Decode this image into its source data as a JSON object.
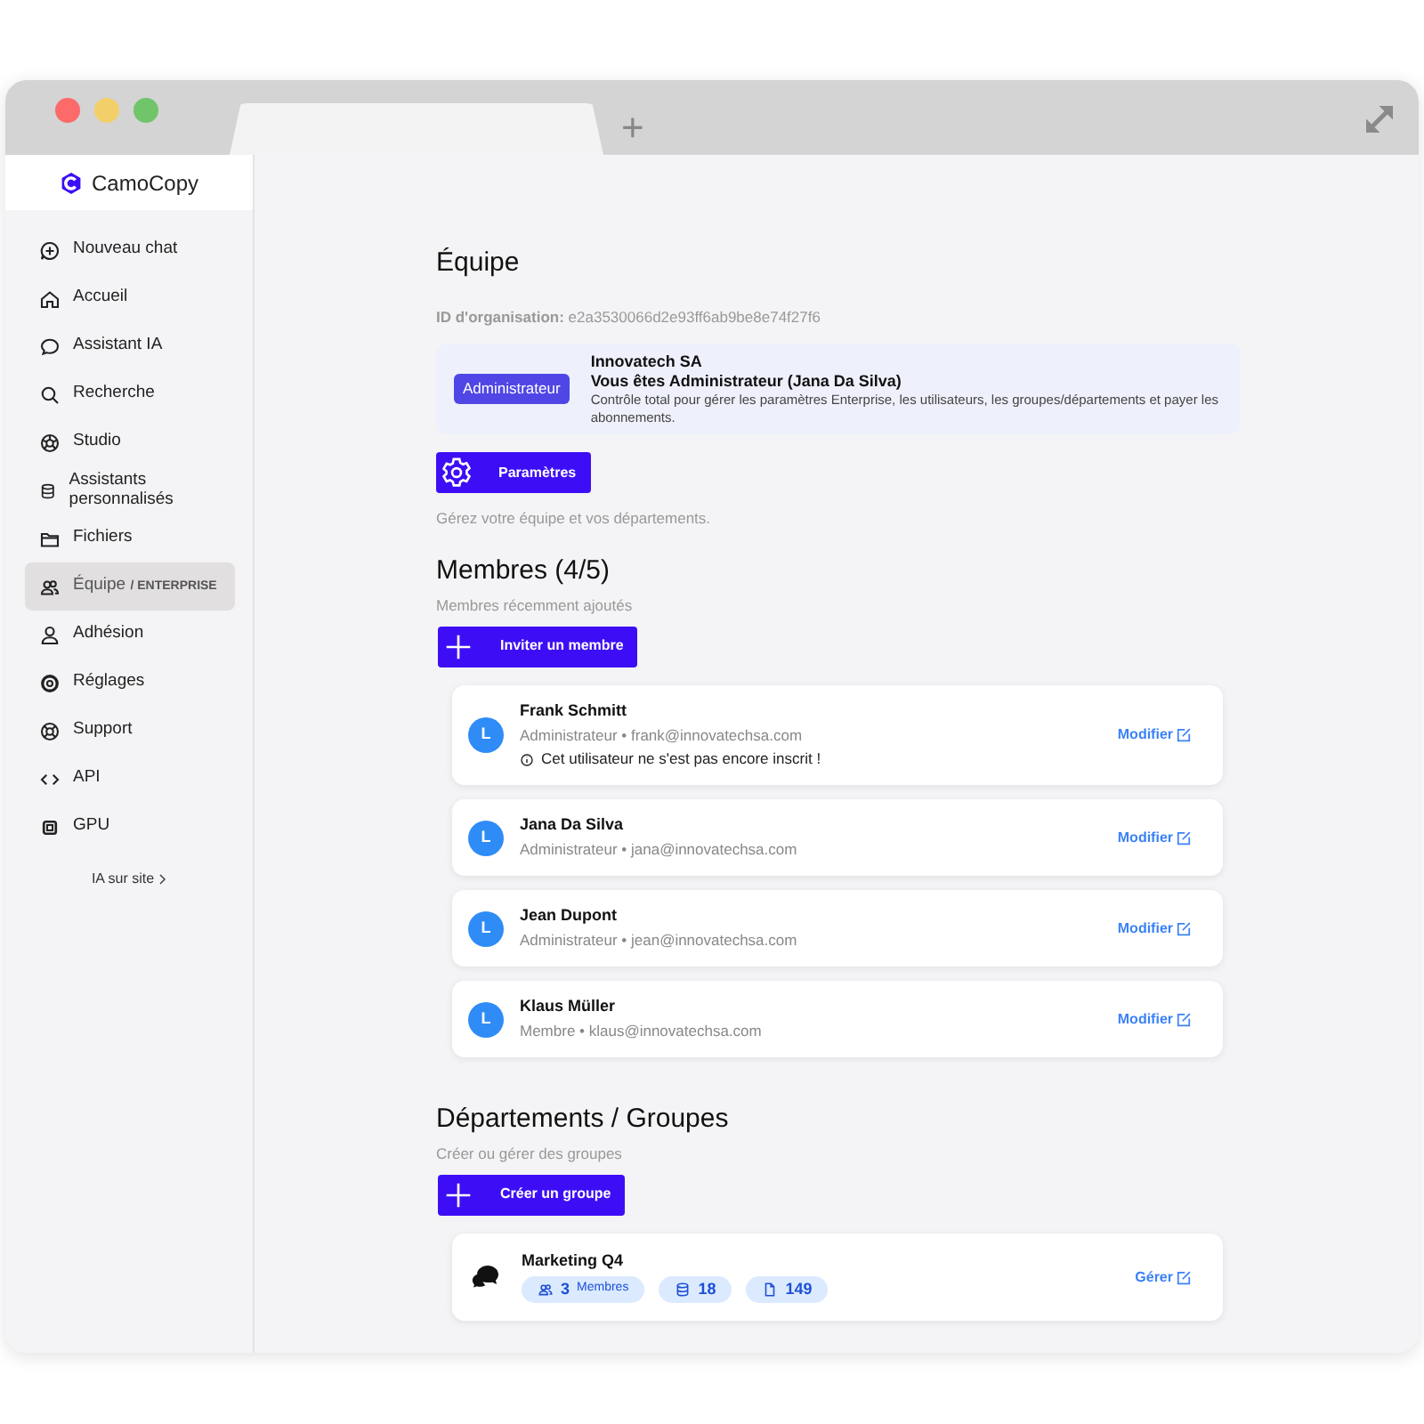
{
  "browser": {
    "new_tab": "+"
  },
  "brand": {
    "name": "CamoCopy"
  },
  "sidebar": {
    "items": [
      {
        "label": "Nouveau chat",
        "selected": false
      },
      {
        "label": "Accueil",
        "selected": false
      },
      {
        "label": "Assistant IA",
        "selected": false
      },
      {
        "label": "Recherche",
        "selected": false
      },
      {
        "label": "Studio",
        "selected": false
      },
      {
        "label": "Assistants personnalisés",
        "selected": false
      },
      {
        "label": "Fichiers",
        "selected": false
      },
      {
        "label": "Équipe",
        "tag": "/ ENTERPRISE",
        "selected": true
      },
      {
        "label": "Adhésion",
        "selected": false
      },
      {
        "label": "Réglages",
        "selected": false
      },
      {
        "label": "Support",
        "selected": false
      },
      {
        "label": "API",
        "selected": false
      },
      {
        "label": "GPU",
        "selected": false
      }
    ],
    "footer_link": "IA sur site"
  },
  "team": {
    "title": "Équipe",
    "org_id_label": "ID d'organisation:",
    "org_id": "e2a3530066d2e93ff6ab9be8e74f27f6",
    "role_badge": "Administrateur",
    "org_name": "Innovatech SA",
    "role_line": "Vous êtes Administrateur (Jana Da Silva)",
    "role_description": "Contrôle total pour gérer les paramètres Enterprise, les utilisateurs, les groupes/départements et payer les abonnements.",
    "settings_button": "Paramètres",
    "hint": "Gérez votre équipe et vos départements."
  },
  "members": {
    "title": "Membres (4/5)",
    "separator": "•",
    "subtitle": "Membres récemment ajoutés",
    "invite_button": "Inviter un membre",
    "items": [
      {
        "avatar": "L",
        "name": "Frank Schmitt",
        "role": "Administrateur",
        "email": "frank@innovatechsa.com",
        "warning": "Cet utilisateur ne s'est pas encore inscrit !",
        "action": "Modifier"
      },
      {
        "avatar": "L",
        "name": "Jana Da Silva",
        "role": "Administrateur",
        "email": "jana@innovatechsa.com",
        "action": "Modifier"
      },
      {
        "avatar": "L",
        "name": "Jean Dupont",
        "role": "Administrateur",
        "email": "jean@innovatechsa.com",
        "action": "Modifier"
      },
      {
        "avatar": "L",
        "name": "Klaus Müller",
        "role": "Membre",
        "email": "klaus@innovatechsa.com",
        "action": "Modifier"
      }
    ]
  },
  "groups": {
    "title": "Départements / Groupes",
    "subtitle": "Créer ou gérer des groupes",
    "create_button": "Créer un groupe",
    "items": [
      {
        "name": "Marketing Q4",
        "members_count": "3",
        "members_label": "Membres",
        "assistants_count": "18",
        "files_count": "149",
        "action": "Gérer"
      }
    ]
  }
}
